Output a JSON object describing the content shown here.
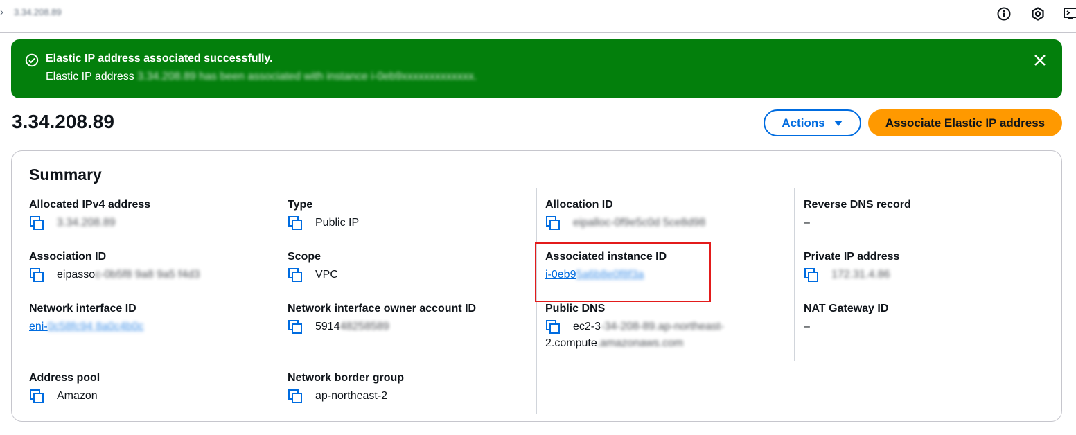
{
  "topbar": {
    "breadcrumb_chevron": "›",
    "breadcrumb_text": "3.34.208.89",
    "icons": [
      "info-icon",
      "settings-gear-icon",
      "cloudshell-icon"
    ]
  },
  "flash": {
    "type": "success",
    "color": "#037f0c",
    "title": "Elastic IP address associated successfully.",
    "body_prefix": "Elastic IP address ",
    "body_rest": "3.34.208.89 has been associated with instance i-0eb9xxxxxxxxxxxxx."
  },
  "header": {
    "title": "3.34.208.89",
    "actions_label": "Actions",
    "associate_label": "Associate Elastic IP address"
  },
  "summary": {
    "title": "Summary",
    "allocated_ipv4": {
      "label": "Allocated IPv4 address",
      "value": "3.34.208.89"
    },
    "association_id": {
      "label": "Association ID",
      "prefix": "eipasso",
      "rest": "c-0b5f8 9a8 9a5 f4d3"
    },
    "network_interface_id": {
      "label": "Network interface ID",
      "prefix": "eni-",
      "rest": "0c58fc94 8a0c4b0c"
    },
    "address_pool": {
      "label": "Address pool",
      "value": "Amazon"
    },
    "type": {
      "label": "Type",
      "value": "Public IP"
    },
    "scope": {
      "label": "Scope",
      "value": "VPC"
    },
    "ni_owner": {
      "label": "Network interface owner account ID",
      "prefix": "5914",
      "rest": "48258589"
    },
    "border_group": {
      "label": "Network border group",
      "value": "ap-northeast-2"
    },
    "allocation_id": {
      "label": "Allocation ID",
      "value": "eipalloc-0f9e5c0d 5ce8d98"
    },
    "associated_instance": {
      "label": "Associated instance ID",
      "prefix": "i-0eb9",
      "rest": "5a6b8e0f8f3a"
    },
    "public_dns": {
      "label": "Public DNS",
      "line1_prefix": "ec2-3",
      "line1_rest": "-34-208-89.ap-northeast-",
      "line2_prefix": "2.compute",
      "line2_rest": ".amazonaws.com"
    },
    "reverse_dns": {
      "label": "Reverse DNS record",
      "value": "–"
    },
    "private_ip": {
      "label": "Private IP address",
      "value": "172.31.4.86"
    },
    "nat_gateway": {
      "label": "NAT Gateway ID",
      "value": "–"
    }
  },
  "colors": {
    "link": "#006ce0",
    "primary_button": "#ff9900",
    "highlight": "#e31b1b"
  }
}
